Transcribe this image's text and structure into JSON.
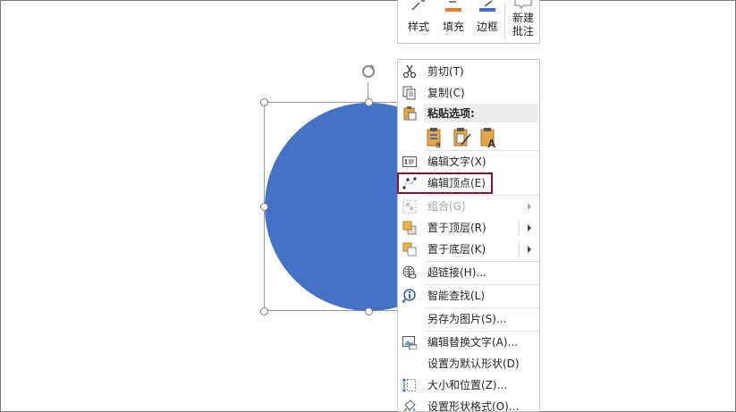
{
  "mini_toolbar": {
    "style_label": "样式",
    "fill_label": "填充",
    "outline_label": "边框",
    "new_comment_line1": "新建",
    "new_comment_line2": "批注"
  },
  "colors": {
    "shape_fill": "#4472c4",
    "fill_accent": "#ed7d31",
    "outline_accent": "#4472c4",
    "highlight_border": "#7b1a2e"
  },
  "context_menu": {
    "cut": "剪切(T)",
    "copy": "复制(C)",
    "paste_options": "粘贴选项:",
    "edit_text": "编辑文字(X)",
    "edit_points": "编辑顶点(E)",
    "group": "组合(G)",
    "bring_to_front": "置于顶层(R)",
    "send_to_back": "置于底层(K)",
    "hyperlink": "超链接(H)...",
    "smart_lookup": "智能查找(L)",
    "save_as_picture": "另存为图片(S)...",
    "edit_alt_text": "编辑替换文字(A)...",
    "set_default_shape": "设置为默认形状(D)",
    "size_and_position": "大小和位置(Z)...",
    "format_shape": "设置形状格式(O)..."
  }
}
